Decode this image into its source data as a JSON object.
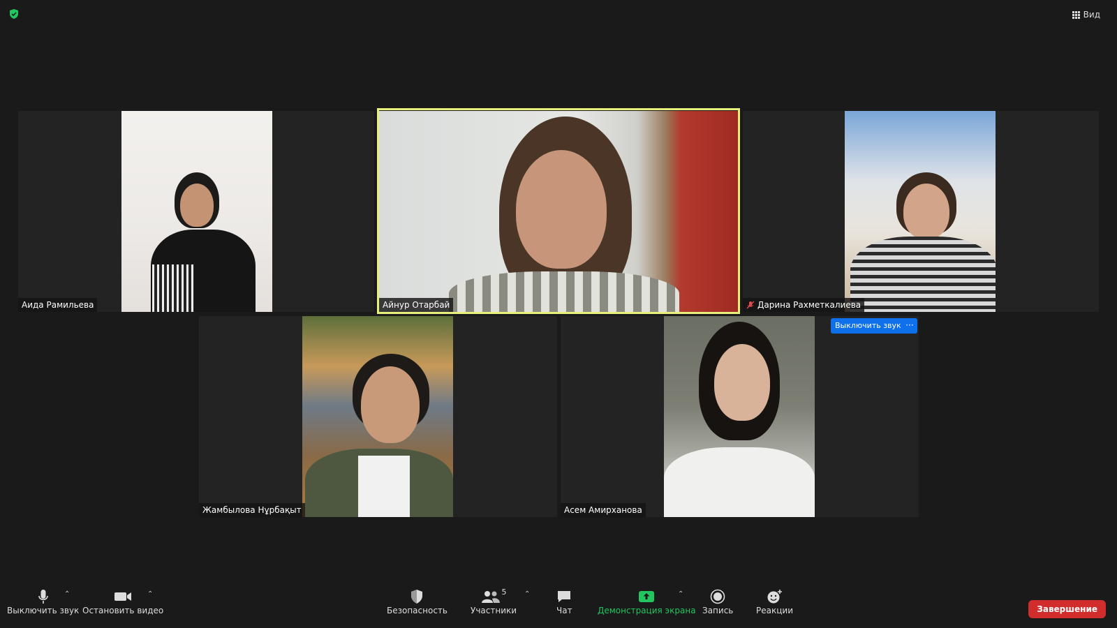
{
  "header": {
    "view_label": "Вид"
  },
  "participants": [
    {
      "name": "Аида Рамильева",
      "muted": false
    },
    {
      "name": "Айнур Отарбай",
      "muted": false,
      "active_speaker": true
    },
    {
      "name": "Дарина Рахметкалиева",
      "muted": true
    },
    {
      "name": "Жамбылова Нұрбақыт",
      "muted": false
    },
    {
      "name": "Асем Амирханова",
      "muted": false
    }
  ],
  "hover_controls": {
    "unmute_label": "Выключить звук",
    "more_label": "···"
  },
  "toolbar": {
    "mute_label": "Выключить звук",
    "video_label": "Остановить видео",
    "security_label": "Безопасность",
    "participants_label": "Участники",
    "participants_count": "5",
    "chat_label": "Чат",
    "share_label": "Демонстрация экрана",
    "record_label": "Запись",
    "reactions_label": "Реакции",
    "end_label": "Завершение"
  },
  "colors": {
    "accent_green": "#22c55e",
    "active_border": "#e6f07a",
    "end_red": "#d12d2d",
    "button_blue": "#0e71eb"
  }
}
